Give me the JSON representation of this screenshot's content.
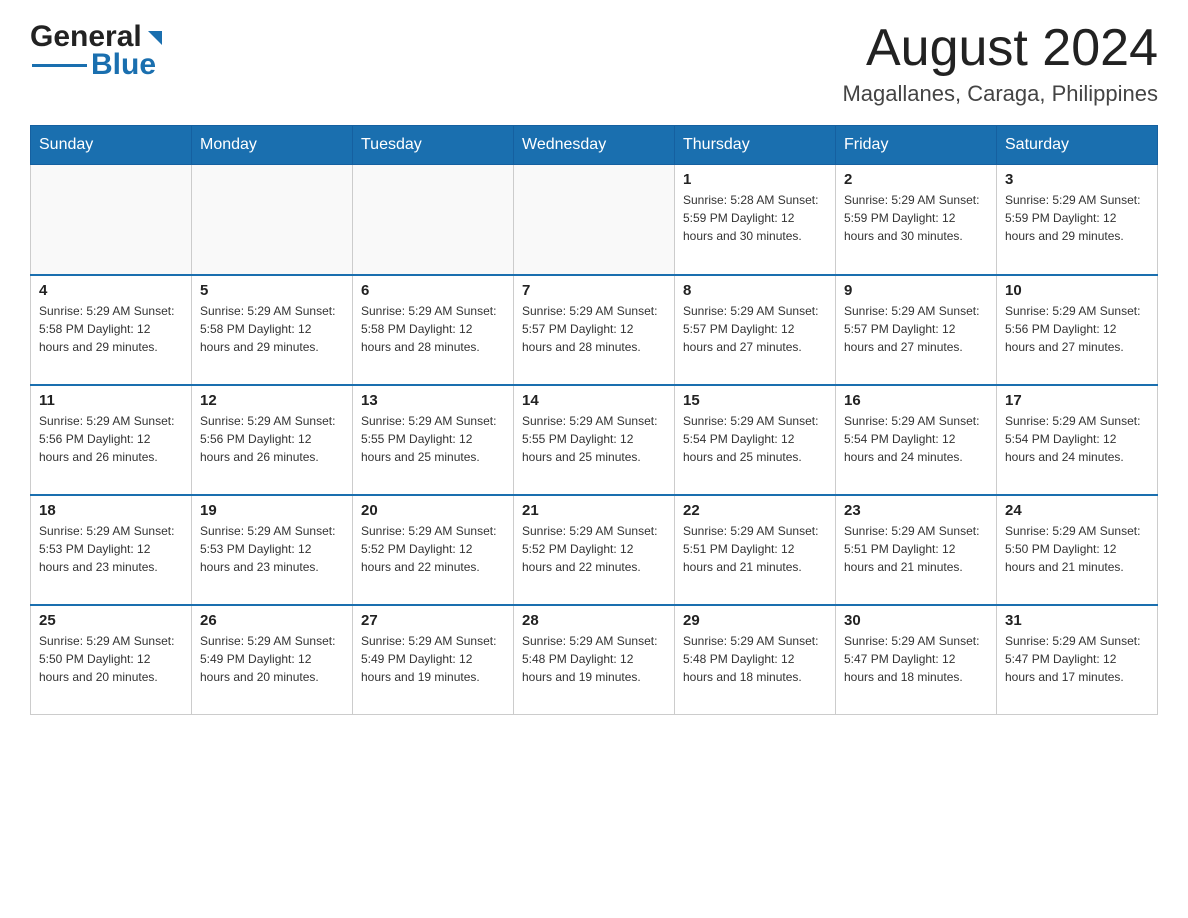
{
  "header": {
    "logo": {
      "general": "General",
      "blue": "Blue"
    },
    "month_title": "August 2024",
    "location": "Magallanes, Caraga, Philippines"
  },
  "calendar": {
    "days_of_week": [
      "Sunday",
      "Monday",
      "Tuesday",
      "Wednesday",
      "Thursday",
      "Friday",
      "Saturday"
    ],
    "weeks": [
      [
        {
          "day": "",
          "info": ""
        },
        {
          "day": "",
          "info": ""
        },
        {
          "day": "",
          "info": ""
        },
        {
          "day": "",
          "info": ""
        },
        {
          "day": "1",
          "info": "Sunrise: 5:28 AM\nSunset: 5:59 PM\nDaylight: 12 hours\nand 30 minutes."
        },
        {
          "day": "2",
          "info": "Sunrise: 5:29 AM\nSunset: 5:59 PM\nDaylight: 12 hours\nand 30 minutes."
        },
        {
          "day": "3",
          "info": "Sunrise: 5:29 AM\nSunset: 5:59 PM\nDaylight: 12 hours\nand 29 minutes."
        }
      ],
      [
        {
          "day": "4",
          "info": "Sunrise: 5:29 AM\nSunset: 5:58 PM\nDaylight: 12 hours\nand 29 minutes."
        },
        {
          "day": "5",
          "info": "Sunrise: 5:29 AM\nSunset: 5:58 PM\nDaylight: 12 hours\nand 29 minutes."
        },
        {
          "day": "6",
          "info": "Sunrise: 5:29 AM\nSunset: 5:58 PM\nDaylight: 12 hours\nand 28 minutes."
        },
        {
          "day": "7",
          "info": "Sunrise: 5:29 AM\nSunset: 5:57 PM\nDaylight: 12 hours\nand 28 minutes."
        },
        {
          "day": "8",
          "info": "Sunrise: 5:29 AM\nSunset: 5:57 PM\nDaylight: 12 hours\nand 27 minutes."
        },
        {
          "day": "9",
          "info": "Sunrise: 5:29 AM\nSunset: 5:57 PM\nDaylight: 12 hours\nand 27 minutes."
        },
        {
          "day": "10",
          "info": "Sunrise: 5:29 AM\nSunset: 5:56 PM\nDaylight: 12 hours\nand 27 minutes."
        }
      ],
      [
        {
          "day": "11",
          "info": "Sunrise: 5:29 AM\nSunset: 5:56 PM\nDaylight: 12 hours\nand 26 minutes."
        },
        {
          "day": "12",
          "info": "Sunrise: 5:29 AM\nSunset: 5:56 PM\nDaylight: 12 hours\nand 26 minutes."
        },
        {
          "day": "13",
          "info": "Sunrise: 5:29 AM\nSunset: 5:55 PM\nDaylight: 12 hours\nand 25 minutes."
        },
        {
          "day": "14",
          "info": "Sunrise: 5:29 AM\nSunset: 5:55 PM\nDaylight: 12 hours\nand 25 minutes."
        },
        {
          "day": "15",
          "info": "Sunrise: 5:29 AM\nSunset: 5:54 PM\nDaylight: 12 hours\nand 25 minutes."
        },
        {
          "day": "16",
          "info": "Sunrise: 5:29 AM\nSunset: 5:54 PM\nDaylight: 12 hours\nand 24 minutes."
        },
        {
          "day": "17",
          "info": "Sunrise: 5:29 AM\nSunset: 5:54 PM\nDaylight: 12 hours\nand 24 minutes."
        }
      ],
      [
        {
          "day": "18",
          "info": "Sunrise: 5:29 AM\nSunset: 5:53 PM\nDaylight: 12 hours\nand 23 minutes."
        },
        {
          "day": "19",
          "info": "Sunrise: 5:29 AM\nSunset: 5:53 PM\nDaylight: 12 hours\nand 23 minutes."
        },
        {
          "day": "20",
          "info": "Sunrise: 5:29 AM\nSunset: 5:52 PM\nDaylight: 12 hours\nand 22 minutes."
        },
        {
          "day": "21",
          "info": "Sunrise: 5:29 AM\nSunset: 5:52 PM\nDaylight: 12 hours\nand 22 minutes."
        },
        {
          "day": "22",
          "info": "Sunrise: 5:29 AM\nSunset: 5:51 PM\nDaylight: 12 hours\nand 21 minutes."
        },
        {
          "day": "23",
          "info": "Sunrise: 5:29 AM\nSunset: 5:51 PM\nDaylight: 12 hours\nand 21 minutes."
        },
        {
          "day": "24",
          "info": "Sunrise: 5:29 AM\nSunset: 5:50 PM\nDaylight: 12 hours\nand 21 minutes."
        }
      ],
      [
        {
          "day": "25",
          "info": "Sunrise: 5:29 AM\nSunset: 5:50 PM\nDaylight: 12 hours\nand 20 minutes."
        },
        {
          "day": "26",
          "info": "Sunrise: 5:29 AM\nSunset: 5:49 PM\nDaylight: 12 hours\nand 20 minutes."
        },
        {
          "day": "27",
          "info": "Sunrise: 5:29 AM\nSunset: 5:49 PM\nDaylight: 12 hours\nand 19 minutes."
        },
        {
          "day": "28",
          "info": "Sunrise: 5:29 AM\nSunset: 5:48 PM\nDaylight: 12 hours\nand 19 minutes."
        },
        {
          "day": "29",
          "info": "Sunrise: 5:29 AM\nSunset: 5:48 PM\nDaylight: 12 hours\nand 18 minutes."
        },
        {
          "day": "30",
          "info": "Sunrise: 5:29 AM\nSunset: 5:47 PM\nDaylight: 12 hours\nand 18 minutes."
        },
        {
          "day": "31",
          "info": "Sunrise: 5:29 AM\nSunset: 5:47 PM\nDaylight: 12 hours\nand 17 minutes."
        }
      ]
    ]
  }
}
